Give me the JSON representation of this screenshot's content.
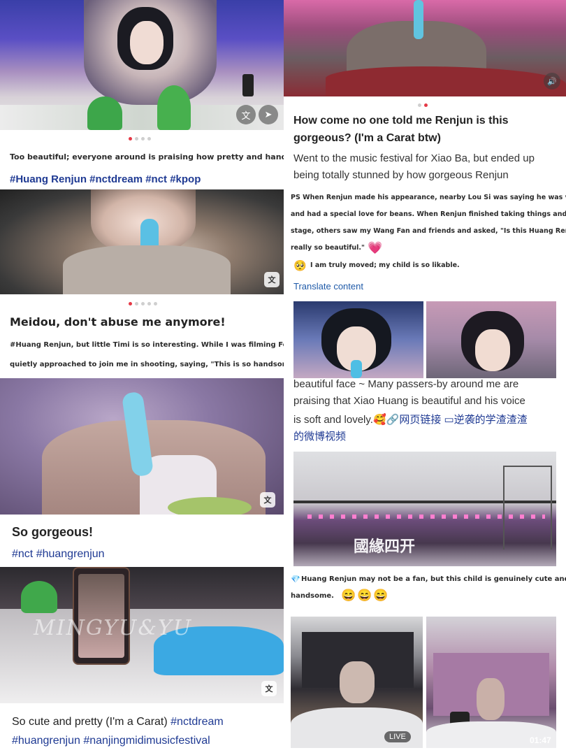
{
  "left": {
    "post1": {
      "caption": "Too beautiful; everyone around is praising how pretty and handsome it is.",
      "tags": "#Huang Renjun #nctdream #nct #kpop"
    },
    "post2": {
      "title": "Meidou, don't abuse me anymore!",
      "body_line1": "#Huang Renjun, but little Timi is so interesting. While I was filming Fools, a passerby",
      "body_line2": "quietly approached to join me in shooting, saying, \"This is so handsome!\""
    },
    "post3": {
      "title": "So gorgeous!",
      "tags": "#nct #huangrenjun"
    },
    "post4": {
      "watermark": "MINGYU&YU",
      "caption_line1_text": "So cute and pretty (I'm a Carat) ",
      "caption_line1_tag": "#nctdream",
      "caption_line2_tags": "#huangrenjun #nanjingmidimusicfestival"
    }
  },
  "right": {
    "post1": {
      "title_line1": "How come no one told me Renjun is this",
      "title_line2": "gorgeous? (I'm a Carat btw)",
      "body_line1": "Went to the music festival for Xiao Ba, but ended up",
      "body_line2": "being totally stunned by how gorgeous Renjun",
      "ps_line1": "PS When Renjun made his appearance, nearby Lou Si was saying he was very pretty",
      "ps_line2": "and had a special love for beans. When Renjun finished taking things and left the",
      "ps_line3": "stage, others saw my Wang Fan and friends and asked, \"Is this Huang Renjun? He's",
      "ps_line4": "really so beautiful.\"",
      "heart": "💗",
      "moved": "I am truly moved; my child is so likable.",
      "moved_emoji": "🥺",
      "translate": "Translate content"
    },
    "post2": {
      "line1": "beautiful face ~ Many passers-by around me are",
      "line2": "praising that Xiao Huang is beautiful and his voice",
      "line3_text": "is soft and lovely.",
      "line3_emoji": "🥰",
      "link1": "🔗网页链接",
      "link2": "▭逆袭的学渣渣渣",
      "line4_link": "的微博视频"
    },
    "post3": {
      "banner": "國緣四开",
      "caption_line1": "Huang Renjun may not be a fan, but this child is genuinely cute and very",
      "caption_line2": "handsome.",
      "emojis": "😄😄😄",
      "gem": "💎"
    },
    "post4": {
      "live": "LIVE",
      "duration": "01:47"
    }
  },
  "colors": {
    "accent_dot": "#e53946",
    "hashtag": "#1f3a93"
  }
}
